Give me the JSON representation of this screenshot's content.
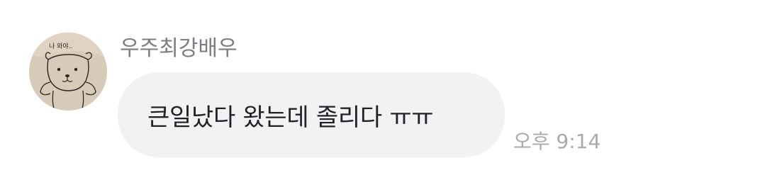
{
  "message": {
    "sender_name": "우주최강배우",
    "avatar_caption": "나 와야..",
    "text": "큰일났다 왔는데 졸리다 ㅠㅠ",
    "time": "오후 9:14"
  },
  "colors": {
    "bubble_bg": "#f2f2f5",
    "name_text": "#7c7c82",
    "time_text": "#a9a9b0",
    "message_text": "#222226"
  }
}
